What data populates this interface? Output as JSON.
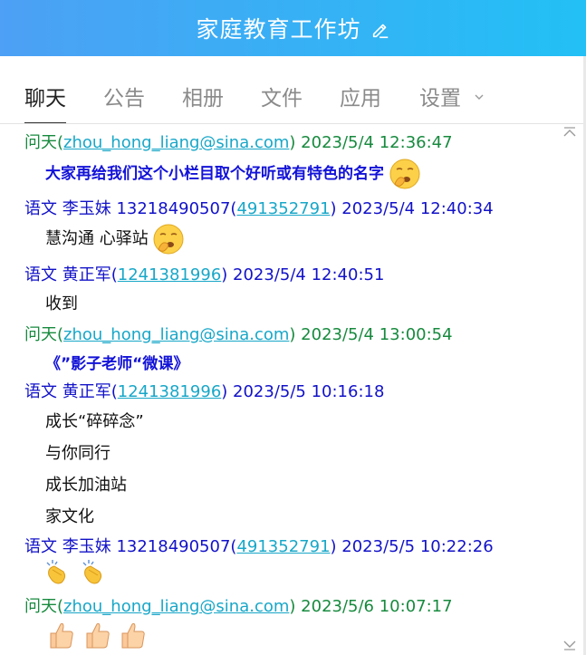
{
  "header": {
    "title": "家庭教育工作坊"
  },
  "tabs": [
    {
      "label": "聊天"
    },
    {
      "label": "公告"
    },
    {
      "label": "相册"
    },
    {
      "label": "文件"
    },
    {
      "label": "应用"
    },
    {
      "label": "设置"
    }
  ],
  "messages": [
    {
      "name": "问天(",
      "link": "zhou_hong_liang@sina.com",
      "suffix": ") 2023/5/4 12:36:47",
      "body": "大家再给我们这个小栏目取个好听或有特色的名字"
    },
    {
      "name": "语文  李玉妹 13218490507(",
      "link": "491352791",
      "suffix": ") 2023/5/4 12:40:34",
      "body": "慧沟通 心驿站"
    },
    {
      "name": "语文  黄正军(",
      "link": "1241381996",
      "suffix": ") 2023/5/4 12:40:51",
      "body": "收到"
    },
    {
      "name": "问天(",
      "link": "zhou_hong_liang@sina.com",
      "suffix": ") 2023/5/4 13:00:54",
      "body": "《”影子老师“微课》"
    },
    {
      "name": "语文  黄正军(",
      "link": "1241381996",
      "suffix": ") 2023/5/5 10:16:18",
      "lines": [
        "成长“碎碎念”",
        "与你同行",
        "成长加油站",
        "家文化"
      ]
    },
    {
      "name": "语文  李玉妹 13218490507(",
      "link": "491352791",
      "suffix": ") 2023/5/5 10:22:26"
    },
    {
      "name": "问天(",
      "link": "zhou_hong_liang@sina.com",
      "suffix": ") 2023/5/6 10:07:17"
    }
  ]
}
